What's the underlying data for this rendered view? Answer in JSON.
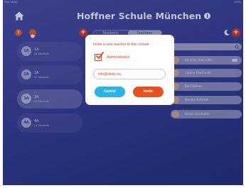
{
  "status_bar": {
    "left": "iPad 16:00",
    "right": "100%"
  },
  "header": {
    "title": "Hoffner Schule München",
    "info_symbol": "i"
  },
  "toolbar": {
    "alert_symbol": "!",
    "add_symbol": "+"
  },
  "tabs": [
    {
      "label": "Students",
      "active": false
    },
    {
      "label": "Teachers",
      "active": true
    }
  ],
  "classes": [
    {
      "badge": "1A",
      "name": "1A",
      "sub": "24 Students"
    },
    {
      "badge": "2A",
      "name": "2A",
      "sub": "22 Students"
    },
    {
      "badge": "3A",
      "name": "3A",
      "sub": "25 Students"
    },
    {
      "badge": "4A",
      "name": "4A",
      "sub": "21 Students"
    }
  ],
  "teachers": [
    {
      "name": "Karoline Seemüller"
    },
    {
      "name": "Sabine Eberhardt"
    },
    {
      "name": "Rolf Söffner"
    },
    {
      "name": "Monika Schmidt"
    },
    {
      "name": "Simon Sonthofer"
    }
  ],
  "dialog": {
    "title": "Invite a new teacher to this school",
    "checkbox_label": "Administrator",
    "checkbox_checked": true,
    "email_value": "info@ekids.eu",
    "cancel_label": "Cancel",
    "invite_label": "Invite"
  },
  "colors": {
    "accent_orange": "#e8501f",
    "cancel_blue": "#29b4e7",
    "background": "#383f93"
  }
}
